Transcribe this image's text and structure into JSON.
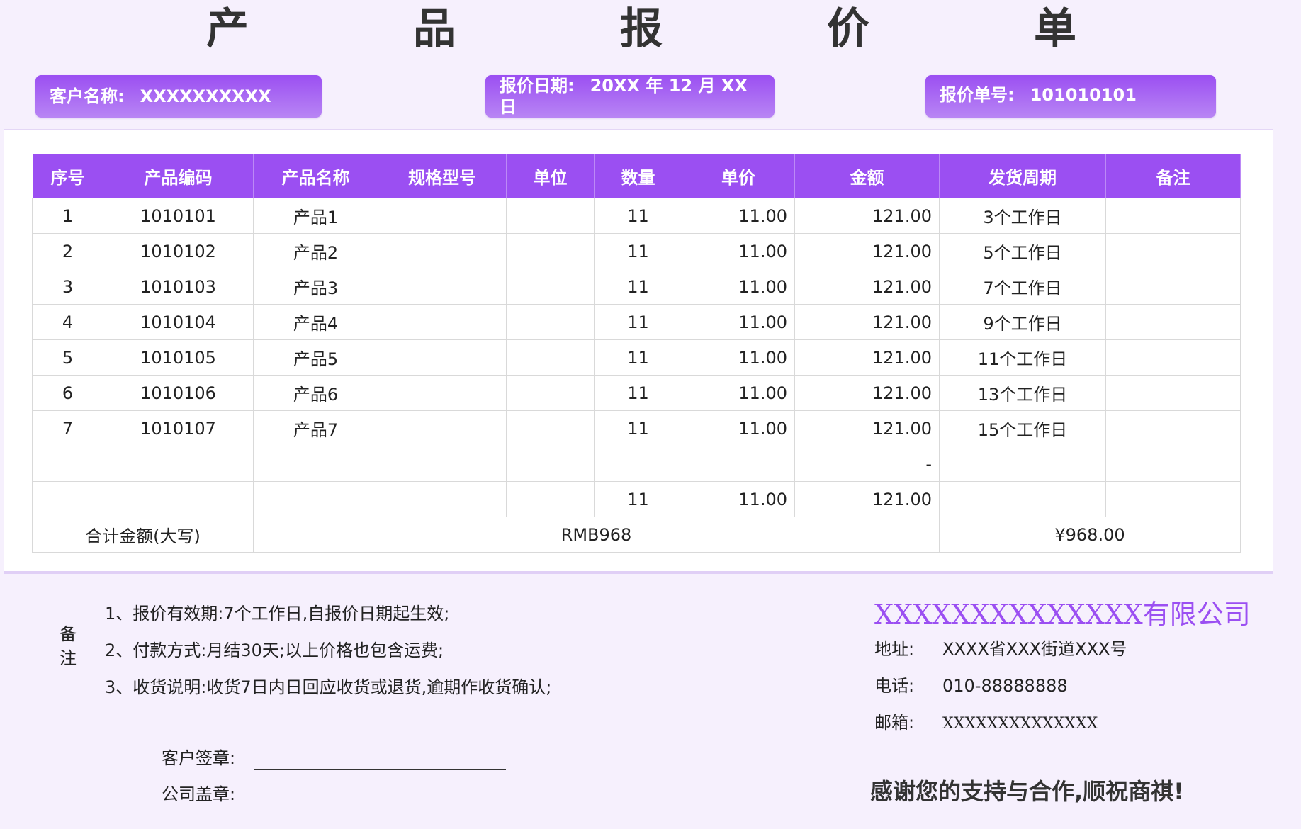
{
  "title": "产　品　报　价　单",
  "customer": {
    "label": "客户名称:",
    "value": "XXXXXXXXXX"
  },
  "date": {
    "label": "报价日期:",
    "value": "20XX 年 12 月 XX 日"
  },
  "quote_no": {
    "label": "报价单号:",
    "value": "101010101"
  },
  "table": {
    "headers": [
      "序号",
      "产品编码",
      "产品名称",
      "规格型号",
      "单位",
      "数量",
      "单价",
      "金额",
      "发货周期",
      "备注"
    ],
    "rows": [
      [
        "1",
        "1010101",
        "产品1",
        "",
        "",
        "11",
        "11.00",
        "121.00",
        "3个工作日",
        ""
      ],
      [
        "2",
        "1010102",
        "产品2",
        "",
        "",
        "11",
        "11.00",
        "121.00",
        "5个工作日",
        ""
      ],
      [
        "3",
        "1010103",
        "产品3",
        "",
        "",
        "11",
        "11.00",
        "121.00",
        "7个工作日",
        ""
      ],
      [
        "4",
        "1010104",
        "产品4",
        "",
        "",
        "11",
        "11.00",
        "121.00",
        "9个工作日",
        ""
      ],
      [
        "5",
        "1010105",
        "产品5",
        "",
        "",
        "11",
        "11.00",
        "121.00",
        "11个工作日",
        ""
      ],
      [
        "6",
        "1010106",
        "产品6",
        "",
        "",
        "11",
        "11.00",
        "121.00",
        "13个工作日",
        ""
      ],
      [
        "7",
        "1010107",
        "产品7",
        "",
        "",
        "11",
        "11.00",
        "121.00",
        "15个工作日",
        ""
      ],
      [
        "",
        "",
        "",
        "",
        "",
        "",
        "",
        "-",
        "",
        ""
      ],
      [
        "",
        "",
        "",
        "",
        "",
        "11",
        "11.00",
        "121.00",
        "",
        ""
      ]
    ],
    "total": {
      "label": "合计金额(大写)",
      "words": "RMB968",
      "amount": "¥968.00"
    }
  },
  "notes": {
    "label": "备注",
    "items": [
      "1、报价有效期:7个工作日,自报价日期起生效;",
      "2、付款方式:月结30天;以上价格也包含运费;",
      "3、收货说明:收货7日内日回应收货或退货,逾期作收货确认;"
    ]
  },
  "sign": {
    "customer": "客户签章:",
    "company": "公司盖章:"
  },
  "company": {
    "name": "XXXXXXXXXXXXXX有限公司",
    "address_label": "地址:",
    "address": "XXXX省XXX街道XXX号",
    "phone_label": "电话:",
    "phone": "010-88888888",
    "email_label": "邮箱:",
    "email": "XXXXXXXXXXXXXX"
  },
  "thanks": "感谢您的支持与合作,顺祝商祺!",
  "colors": {
    "accent": "#9b4ff2",
    "background": "#f6f0fd"
  }
}
